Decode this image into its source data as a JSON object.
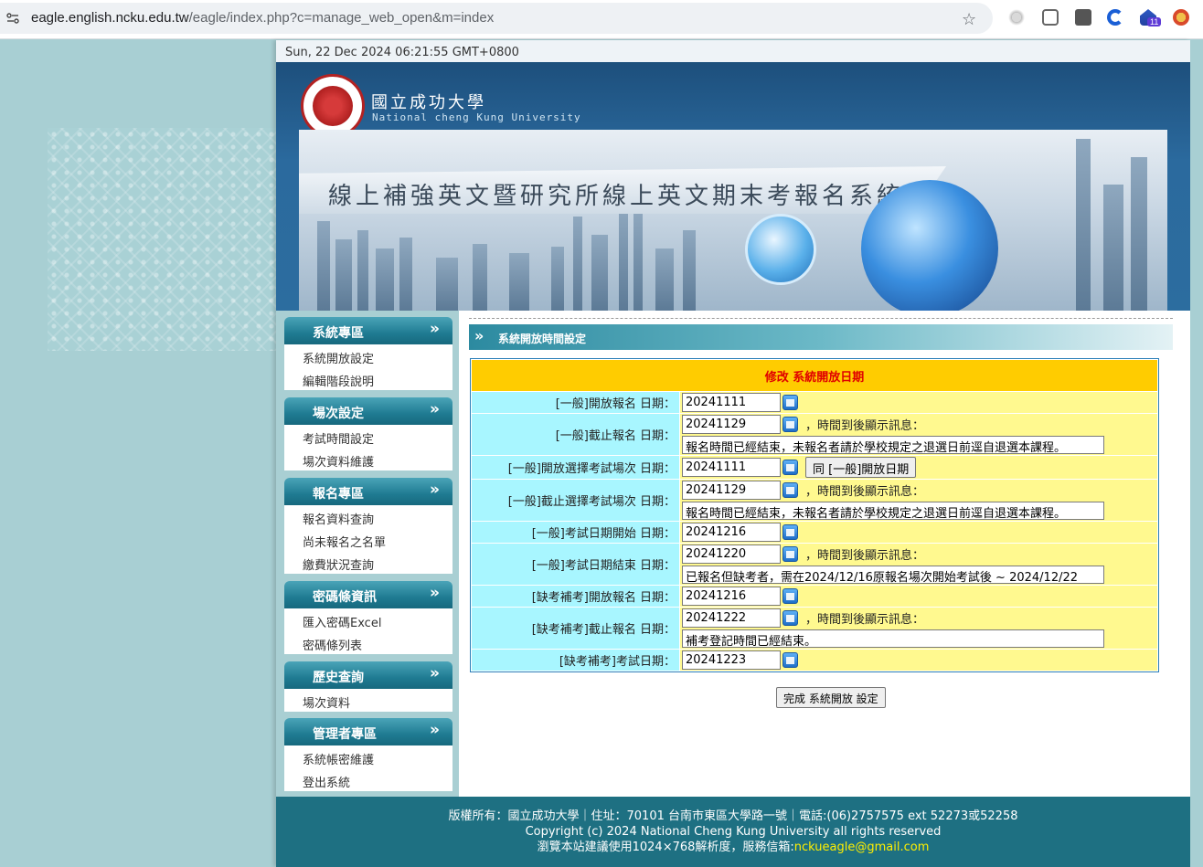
{
  "browser": {
    "url_host": "eagle.english.ncku.edu.tw",
    "url_path": "/eagle/index.php?c=manage_web_open&m=index",
    "extension_badge": "11"
  },
  "page": {
    "datetime": "Sun, 22 Dec 2024 06:21:55 GMT+0800"
  },
  "header": {
    "university_name": "國立成功大學",
    "university_name_en": "National cheng Kung University",
    "banner_title": "線上補強英文暨研究所線上英文期末考報名系統"
  },
  "sidebar": {
    "sections": [
      {
        "title": "系統專區",
        "items": [
          "系統開放設定",
          "編輯階段說明"
        ]
      },
      {
        "title": "場次設定",
        "items": [
          "考試時間設定",
          "場次資料維護"
        ]
      },
      {
        "title": "報名專區",
        "items": [
          "報名資料查詢",
          "尚未報名之名單",
          "繳費狀況查詢"
        ]
      },
      {
        "title": "密碼條資訊",
        "items": [
          "匯入密碼Excel",
          "密碼條列表"
        ]
      },
      {
        "title": "歷史查詢",
        "items": [
          "場次資料"
        ]
      },
      {
        "title": "管理者專區",
        "items": [
          "系統帳密維護",
          "登出系統"
        ]
      }
    ]
  },
  "main": {
    "section_title": "系統開放時間設定",
    "form_caption": "修改 系統開放日期",
    "note_label": "，時間到後顯示訊息：",
    "same_button": "同 [一般]開放日期",
    "submit_button": "完成 系統開放 設定",
    "rows": [
      {
        "label": "[一般]開放報名 日期：",
        "value": "20241111"
      },
      {
        "label": "[一般]截止報名 日期：",
        "value": "20241129",
        "message": "報名時間已經結束，未報名者請於學校規定之退選日前逕自退選本課程。"
      },
      {
        "label": "[一般]開放選擇考試場次 日期：",
        "value": "20241111"
      },
      {
        "label": "[一般]截止選擇考試場次 日期：",
        "value": "20241129",
        "message": "報名時間已經結束，未報名者請於學校規定之退選日前逕自退選本課程。"
      },
      {
        "label": "[一般]考試日期開始 日期：",
        "value": "20241216"
      },
      {
        "label": "[一般]考試日期結束 日期：",
        "value": "20241220",
        "message": "已報名但缺考者，需在2024/12/16原報名場次開始考試後 ~ 2024/12/22"
      },
      {
        "label": "[缺考補考]開放報名 日期：",
        "value": "20241216"
      },
      {
        "label": "[缺考補考]截止報名 日期：",
        "value": "20241222",
        "message": "補考登記時間已經結束。"
      },
      {
        "label": "[缺考補考]考試日期：",
        "value": "20241223"
      }
    ]
  },
  "footer": {
    "line1": "版權所有：國立成功大學｜住址：70101 台南市東區大學路一號｜電話:(06)2757575 ext 52273或52258",
    "line2": "Copyright (c) 2024 National Cheng Kung University all rights reserved",
    "line3_prefix": "瀏覽本站建議使用1024×768解析度，服務信箱:",
    "email": "nckueagle@gmail.com"
  },
  "colors": {
    "header_blue": "#1d4f7c",
    "sidebar_title_teal": "#1f7b92",
    "caption_yellow": "#ffcc00",
    "caption_text_red": "#e00000",
    "label_cyan": "#a8f6ff",
    "value_yellow": "#fff98f",
    "footer_teal": "#1e7082",
    "footer_email": "#ffef00"
  }
}
